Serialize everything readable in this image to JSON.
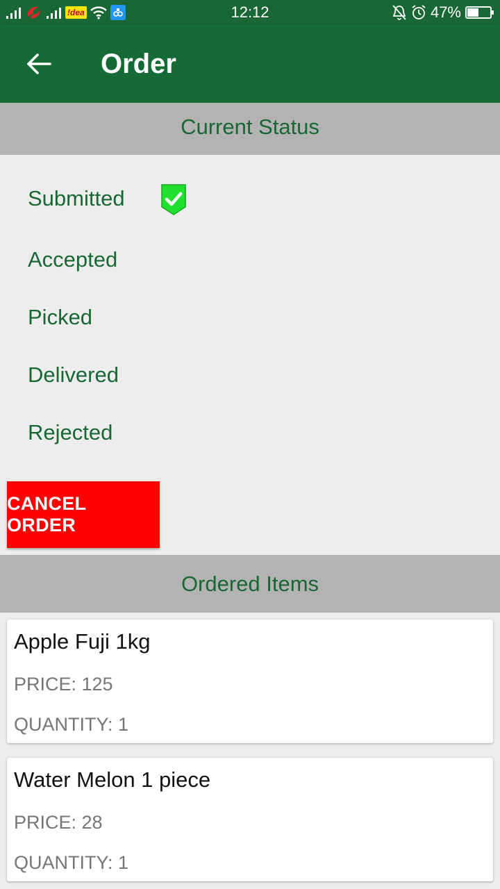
{
  "status_bar": {
    "carrier_badge": "!dea",
    "time": "12:12",
    "battery": "47%"
  },
  "app_bar": {
    "title": "Order",
    "back_icon": "arrow-left-icon"
  },
  "current_status": {
    "header": "Current Status",
    "steps": [
      {
        "label": "Submitted",
        "checked": true
      },
      {
        "label": "Accepted",
        "checked": false
      },
      {
        "label": "Picked",
        "checked": false
      },
      {
        "label": "Delivered",
        "checked": false
      },
      {
        "label": "Rejected",
        "checked": false
      }
    ]
  },
  "cancel_button": {
    "label": "CANCEL ORDER"
  },
  "ordered_items": {
    "header": "Ordered Items",
    "items": [
      {
        "name": "Apple Fuji 1kg",
        "price": "PRICE: 125",
        "quantity": "QUANTITY: 1"
      },
      {
        "name": "Water Melon 1 piece",
        "price": "PRICE: 28",
        "quantity": "QUANTITY: 1"
      }
    ]
  },
  "colors": {
    "app_bar": "#146b36",
    "status_bar": "#186734",
    "section_header_bg": "#b3b3b3",
    "accent_text": "#186734",
    "cancel_button": "#ff0000",
    "check_badge": "#22e02e"
  }
}
